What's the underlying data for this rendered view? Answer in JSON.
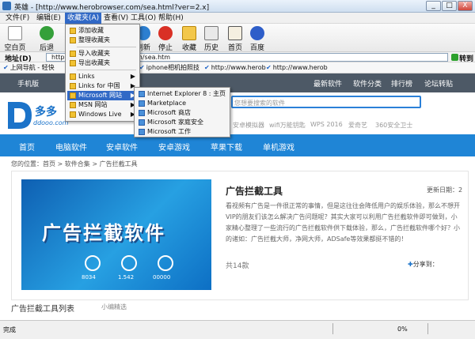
{
  "window": {
    "title": "英雄 - [http://www.herobrowser.com/sea.html?ver=2.x]",
    "min": "_",
    "max": "□",
    "close": "X"
  },
  "menubar": [
    "文件(F)",
    "编辑(E)",
    "收藏夹(A)",
    "查看(V)",
    "工具(O)",
    "帮助(H)"
  ],
  "toolbar": {
    "items": [
      "空白页",
      "后退",
      "刷新",
      "停止",
      "收藏",
      "历史",
      "首页",
      "百度"
    ]
  },
  "address": {
    "label": "地址(D)",
    "value": "http://www.herobrowser.com/sea.htm",
    "go": "转到"
  },
  "favorites": [
    "上网导航 - 轻快",
    "iphone相机拍照技",
    "http://www.herob",
    "http://www.herob"
  ],
  "favmenu": {
    "items": [
      "添加收藏",
      "整理收藏夹",
      "导入收藏夹",
      "导出收藏夹",
      "Links",
      "Links for 中国",
      "Microsoft 网站",
      "MSN 网站",
      "Windows Live"
    ]
  },
  "submenu": {
    "items": [
      "Internet Explorer 8 : 主页",
      "Marketplace",
      "Microsoft 商店",
      "Microsoft 家庭安全",
      "Microsoft 工作"
    ]
  },
  "site": {
    "top": {
      "mobile": "手机版",
      "links": [
        "最新软件",
        "软件分类",
        "排行榜",
        "论坛转贴"
      ]
    },
    "logo": {
      "text": "多多",
      "sub": "ddooo.com"
    },
    "search": {
      "placeholder": "您想要搜索的软件",
      "keywords": [
        "安卓模拟器",
        "wifi万能钥匙",
        "WPS 2016",
        "爱奇艺",
        "360安全卫士"
      ]
    },
    "nav": [
      "首页",
      "电脑软件",
      "安卓软件",
      "安卓游戏",
      "苹果下载",
      "单机游戏"
    ],
    "breadcrumb": "您的位置：首页 > 软件合集 > 广告拦截工具",
    "article": {
      "title": "广告拦截工具",
      "date": "更新日期：2",
      "lines": [
        "看视频有广告是一件很正常的事情，但是这往往会降低用户的娱乐体验，那么不想开",
        "VIP的朋友们该怎么解决广告问题呢？其实大家可以利用广告拦截软件即可做到，小",
        "家精心整理了一些流行的广告拦截软件供下载体验，那么，广告拦截软件哪个好？小",
        "的诸如：广告拦截大师，净网大师，ADSafe等效果都挺不错的！"
      ],
      "count": "共14款",
      "share": "分享到："
    },
    "banner": {
      "text": "广告拦截软件",
      "stats": [
        "8034",
        "1.542",
        "00000"
      ]
    },
    "list": {
      "title": "广告拦截工具列表",
      "sub": "小编精选"
    }
  },
  "status": {
    "text": "完成",
    "pct": "0%"
  }
}
